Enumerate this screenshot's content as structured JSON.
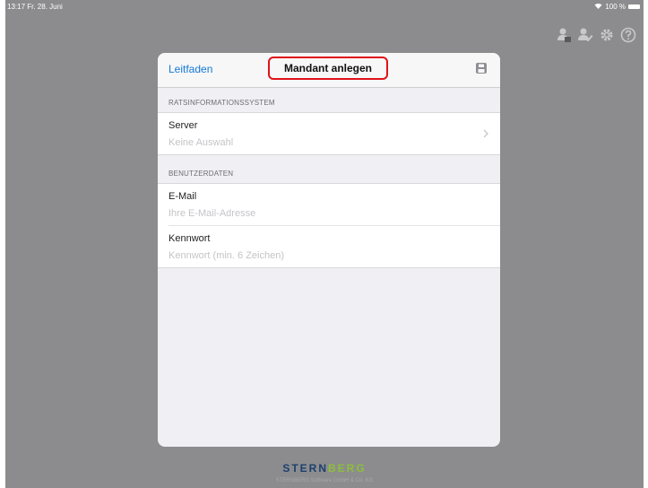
{
  "statusbar": {
    "time_date": "13:17  Fr. 28. Juni",
    "battery": "100 %"
  },
  "toolbar": {
    "icons": [
      "user-remove-icon",
      "user-edit-icon",
      "gear-icon",
      "help-icon"
    ]
  },
  "modal": {
    "nav": {
      "back_label": "Leitfaden",
      "title": "Mandant anlegen",
      "save_icon": "save-icon"
    },
    "sections": {
      "ratsinfo": {
        "header": "RATSINFORMATIONSSYSTEM",
        "server": {
          "title": "Server",
          "value": "Keine Auswahl"
        }
      },
      "benutzer": {
        "header": "BENUTZERDATEN",
        "email": {
          "title": "E-Mail",
          "placeholder": "Ihre E-Mail-Adresse"
        },
        "password": {
          "title": "Kennwort",
          "placeholder": "Kennwort (min. 6 Zeichen)"
        }
      }
    }
  },
  "footer": {
    "logo_part1": "STERN",
    "logo_part2": "BERG",
    "subtitle": "STERNBERG Software GmbH & Co. KG"
  },
  "colors": {
    "accent": "#1478d6",
    "highlight": "#e0121b",
    "background": "#8c8c8e"
  }
}
